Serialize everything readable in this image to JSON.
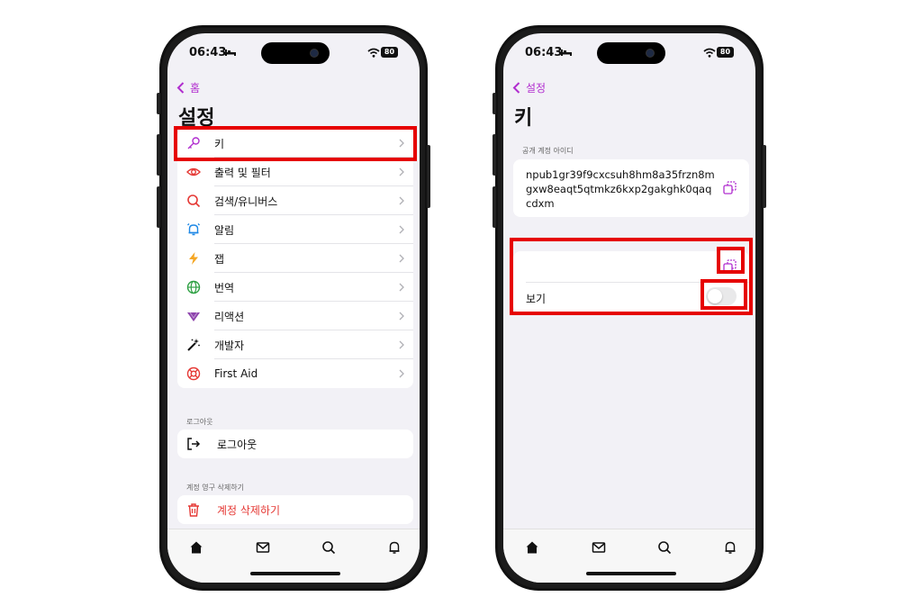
{
  "status": {
    "time": "06:43",
    "battery": "80"
  },
  "left": {
    "back_label": "홈",
    "title": "설정",
    "items": [
      {
        "label": "키",
        "icon": "key-icon",
        "color": "#b12ecf"
      },
      {
        "label": "출력 및 필터",
        "icon": "eye-icon",
        "color": "#e53935"
      },
      {
        "label": "검색/유니버스",
        "icon": "search-icon",
        "color": "#e53935"
      },
      {
        "label": "알림",
        "icon": "bell-icon",
        "color": "#1e88e5"
      },
      {
        "label": "잽",
        "icon": "lightning-icon",
        "color": "#f5a623"
      },
      {
        "label": "번역",
        "icon": "globe-icon",
        "color": "#2ea043"
      },
      {
        "label": "리액션",
        "icon": "reaction-icon",
        "color": "#8e44ad"
      },
      {
        "label": "개발자",
        "icon": "magic-wand-icon",
        "color": "#111111"
      },
      {
        "label": "First Aid",
        "icon": "lifebuoy-icon",
        "color": "#e53935"
      }
    ],
    "logout_header": "로그아웃",
    "logout_label": "로그아웃",
    "delete_header": "계정 영구 삭제하기",
    "delete_label": "계정 삭제하기",
    "delete_color": "#e53935"
  },
  "right": {
    "back_label": "설정",
    "title": "키",
    "public_header": "공개 계정 아이디",
    "public_key": "npub1gr39f9cxcsuh8hm8a35frzn8mgxw8eaqt5qtmkz6kxp2gakghk0qaqcdxm",
    "show_label": "보기",
    "show_enabled": false
  },
  "tabs": [
    "home-icon",
    "mail-icon",
    "search-icon",
    "bell-icon"
  ],
  "accent": "#b12ecf",
  "highlight_color": "#e60000"
}
